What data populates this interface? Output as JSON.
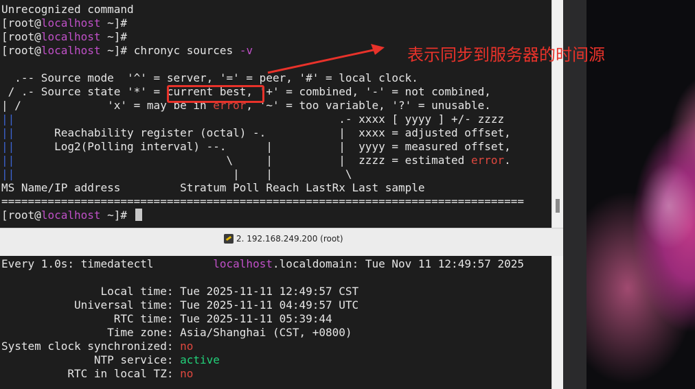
{
  "terminal_top": {
    "lines": [
      "Unrecognized command",
      "[root@localhost ~]#",
      "[root@localhost ~]#",
      "[root@localhost ~]# chronyc sources -v",
      "",
      "  .-- Source mode  '^' = server, '=' = peer, '#' = local clock.",
      " / .- Source state '*' = current best, '+' = combined, '-' = not combined,",
      "| /             'x' = may be in error, '~' = too variable, '?' = unusable.",
      "||                                                 .- xxxx [ yyyy ] +/- zzzz",
      "||      Reachability register (octal) -.           |  xxxx = adjusted offset,",
      "||      Log2(Polling interval) --.      |          |  yyyy = measured offset,",
      "||                                \\     |          |  zzzz = estimated error.",
      "||                                 |    |           \\",
      "MS Name/IP address         Stratum Poll Reach LastRx Last sample",
      "===============================================================================",
      "[root@localhost ~]#"
    ],
    "prompt_user": "root",
    "prompt_host": "localhost",
    "prompt_path": "~",
    "command": "chronyc sources",
    "command_flag": "-v",
    "error_word": "error"
  },
  "tab": {
    "label": "2. 192.168.249.200 (root)"
  },
  "terminal_bottom": {
    "header_left": "Every 1.0s: timedatectl",
    "header_host": "localhost",
    "header_rest": ".localdomain: Tue Nov 11 12:49:57 2025",
    "rows": [
      {
        "label": "Local time:",
        "value": "Tue 2025-11-11 12:49:57 CST"
      },
      {
        "label": "Universal time:",
        "value": "Tue 2025-11-11 04:49:57 UTC"
      },
      {
        "label": "RTC time:",
        "value": "Tue 2025-11-11 05:39:44"
      },
      {
        "label": "Time zone:",
        "value": "Asia/Shanghai (CST, +0800)"
      },
      {
        "label": "System clock synchronized:",
        "value": "no"
      },
      {
        "label": "NTP service:",
        "value": "active"
      },
      {
        "label": "RTC in local TZ:",
        "value": "no"
      }
    ]
  },
  "annotation": {
    "text": "表示同步到服务器的时间源",
    "color": "#e8322a"
  },
  "colors": {
    "host": "#c050c8",
    "error": "#e0483f",
    "active": "#22d17a",
    "gutter": "#3c64d2"
  }
}
